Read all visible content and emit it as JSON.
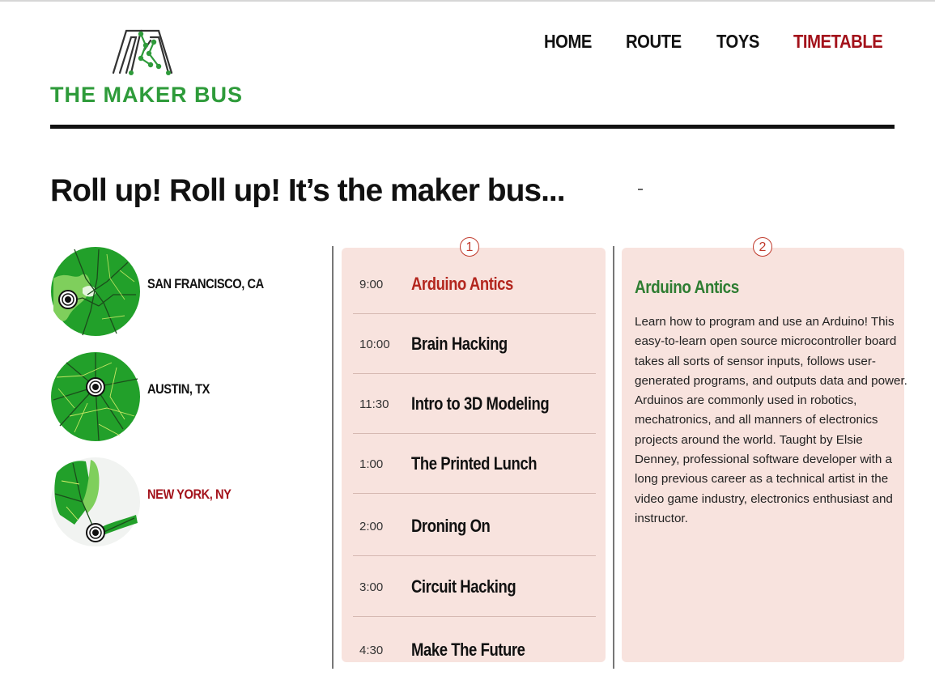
{
  "brand": {
    "name": "THE MAKER BUS",
    "color": "#2e9b3a"
  },
  "nav": {
    "items": [
      {
        "label": "HOME"
      },
      {
        "label": "ROUTE"
      },
      {
        "label": "TOYS"
      },
      {
        "label": "TIMETABLE"
      }
    ],
    "active": "TIMETABLE",
    "active_color": "#a3121b"
  },
  "headline": "Roll up! Roll up! It’s the maker bus...",
  "cities": [
    {
      "label": "SAN FRANCISCO, CA",
      "icon": "map-san-francisco-icon"
    },
    {
      "label": "AUSTIN, TX",
      "icon": "map-austin-icon"
    },
    {
      "label": "NEW YORK, NY",
      "icon": "map-new-york-icon"
    }
  ],
  "selected_city": "NEW YORK, NY",
  "markers": {
    "schedule": "1",
    "detail": "2"
  },
  "schedule": [
    {
      "time": "9:00",
      "title": "Arduino Antics"
    },
    {
      "time": "10:00",
      "title": "Brain Hacking"
    },
    {
      "time": "11:30",
      "title": "Intro to 3D Modeling"
    },
    {
      "time": "1:00",
      "title": "The Printed Lunch"
    },
    {
      "time": "2:00",
      "title": "Droning On"
    },
    {
      "time": "3:00",
      "title": "Circuit Hacking"
    },
    {
      "time": "4:30",
      "title": "Make The Future"
    }
  ],
  "selected_session": "Arduino Antics",
  "detail": {
    "title": "Arduino Antics",
    "body": "Learn how to program and use an Arduino! This easy-to-learn open source microcontroller board takes all sorts of sensor inputs, follows user-generated programs, and outputs data and power. Arduinos are commonly used in robotics, mechatronics, and all manners of electronics projects around the world. Taught by Elsie Denney, professional software developer with a long previous career as a technical artist in the video game industry, electronics enthusiast and instructor."
  },
  "colors": {
    "panel_bg": "#f8e3de",
    "accent_red": "#a3121b",
    "detail_title_green": "#2e7d32",
    "map_green": "#22a02a"
  }
}
